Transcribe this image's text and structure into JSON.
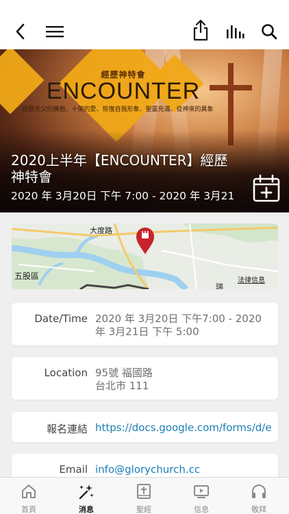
{
  "topbar": {
    "back_icon": "chevron-left-icon",
    "menu_icon": "hamburger-menu-icon",
    "share_icon": "share-icon",
    "audio_icon": "equalizer-icon",
    "search_icon": "search-icon"
  },
  "hero": {
    "banner_small": "經歷神特會",
    "banner_title": "ENCOUNTER",
    "banner_subtitle": "經歷天父的擁抱、十架的愛、恢復自我形象、聖靈充滿、從神來的異象",
    "title": "2020上半年【ENCOUNTER】經歷神特會",
    "dates": "2020 年 3月20日 下午 7:00 - 2020 年 3月21",
    "calendar_icon": "add-to-calendar-icon"
  },
  "map": {
    "labels": [
      "大度路",
      "五股區",
      "法律信息",
      "瑞"
    ],
    "pin_icon": "map-pin-icon"
  },
  "details": [
    {
      "label": "Date/Time",
      "value_lines": [
        "2020 年 3月20日 下午7:00 - 2020",
        "年 3月21日 下午 5:00"
      ],
      "link": false
    },
    {
      "label": "Location",
      "value_lines": [
        "95號 福國路",
        "台北市 111"
      ],
      "link": false
    },
    {
      "label": "報名連結",
      "value_lines": [
        "https://docs.google.com/forms/d/e"
      ],
      "link": true
    },
    {
      "label": "Email",
      "value_lines": [
        "info@glorychurch.cc"
      ],
      "link": true
    }
  ],
  "tabs": [
    {
      "label": "首頁",
      "icon": "home-icon",
      "active": false
    },
    {
      "label": "消息",
      "icon": "news-sparkle-icon",
      "active": true
    },
    {
      "label": "聖經",
      "icon": "bible-icon",
      "active": false
    },
    {
      "label": "信息",
      "icon": "video-message-icon",
      "active": false
    },
    {
      "label": "敬拜",
      "icon": "headphones-icon",
      "active": false
    }
  ],
  "colors": {
    "link": "#1a7fb5",
    "banner_gold": "#f0a817",
    "pin_red": "#c8232c"
  }
}
